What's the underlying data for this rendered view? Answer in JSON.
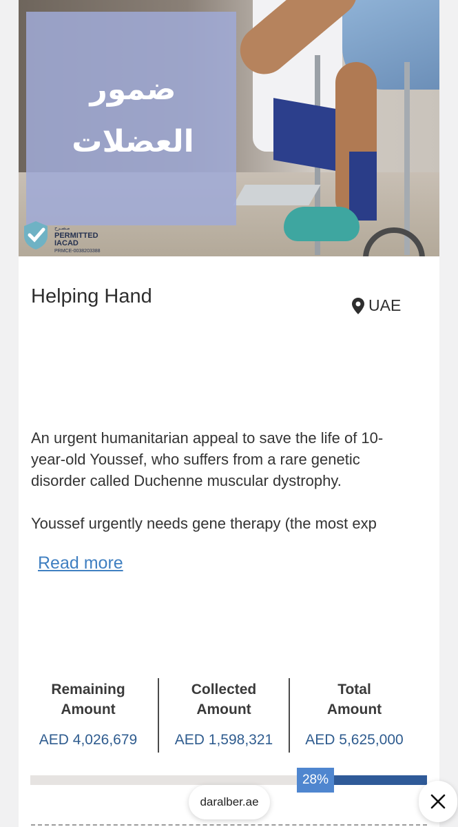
{
  "campaign": {
    "image_title_ar": "ضمور العضلات",
    "badge": {
      "line1": "مـصـرح",
      "line2": "PERMITTED",
      "line3": "IACAD",
      "line4": "PRMCE-0038203388"
    },
    "organization": "Helping Hand",
    "location": "UAE",
    "location_icon": "map-pin-icon",
    "description": [
      "An urgent humanitarian appeal to save the life of 10-year-old Youssef, who suffers from a rare genetic disorder called Duchenne muscular dystrophy.",
      "Youssef urgently needs gene therapy (the most exp"
    ],
    "read_more": "Read more"
  },
  "stats": {
    "remaining": {
      "label": "Remaining\nAmount",
      "value": "AED 4,026,679"
    },
    "collected": {
      "label": "Collected\nAmount",
      "value": "AED 1,598,321"
    },
    "total": {
      "label": "Total\nAmount",
      "value": "AED 5,625,000"
    }
  },
  "progress": {
    "percent": 28,
    "label": "28%"
  },
  "browser": {
    "url": "daralber.ae",
    "close_icon": "close-icon"
  },
  "colors": {
    "accent": "#2f5a98",
    "badge": "#4f86cf",
    "link": "#3f7fc1",
    "overlay": "#a0aad6"
  }
}
